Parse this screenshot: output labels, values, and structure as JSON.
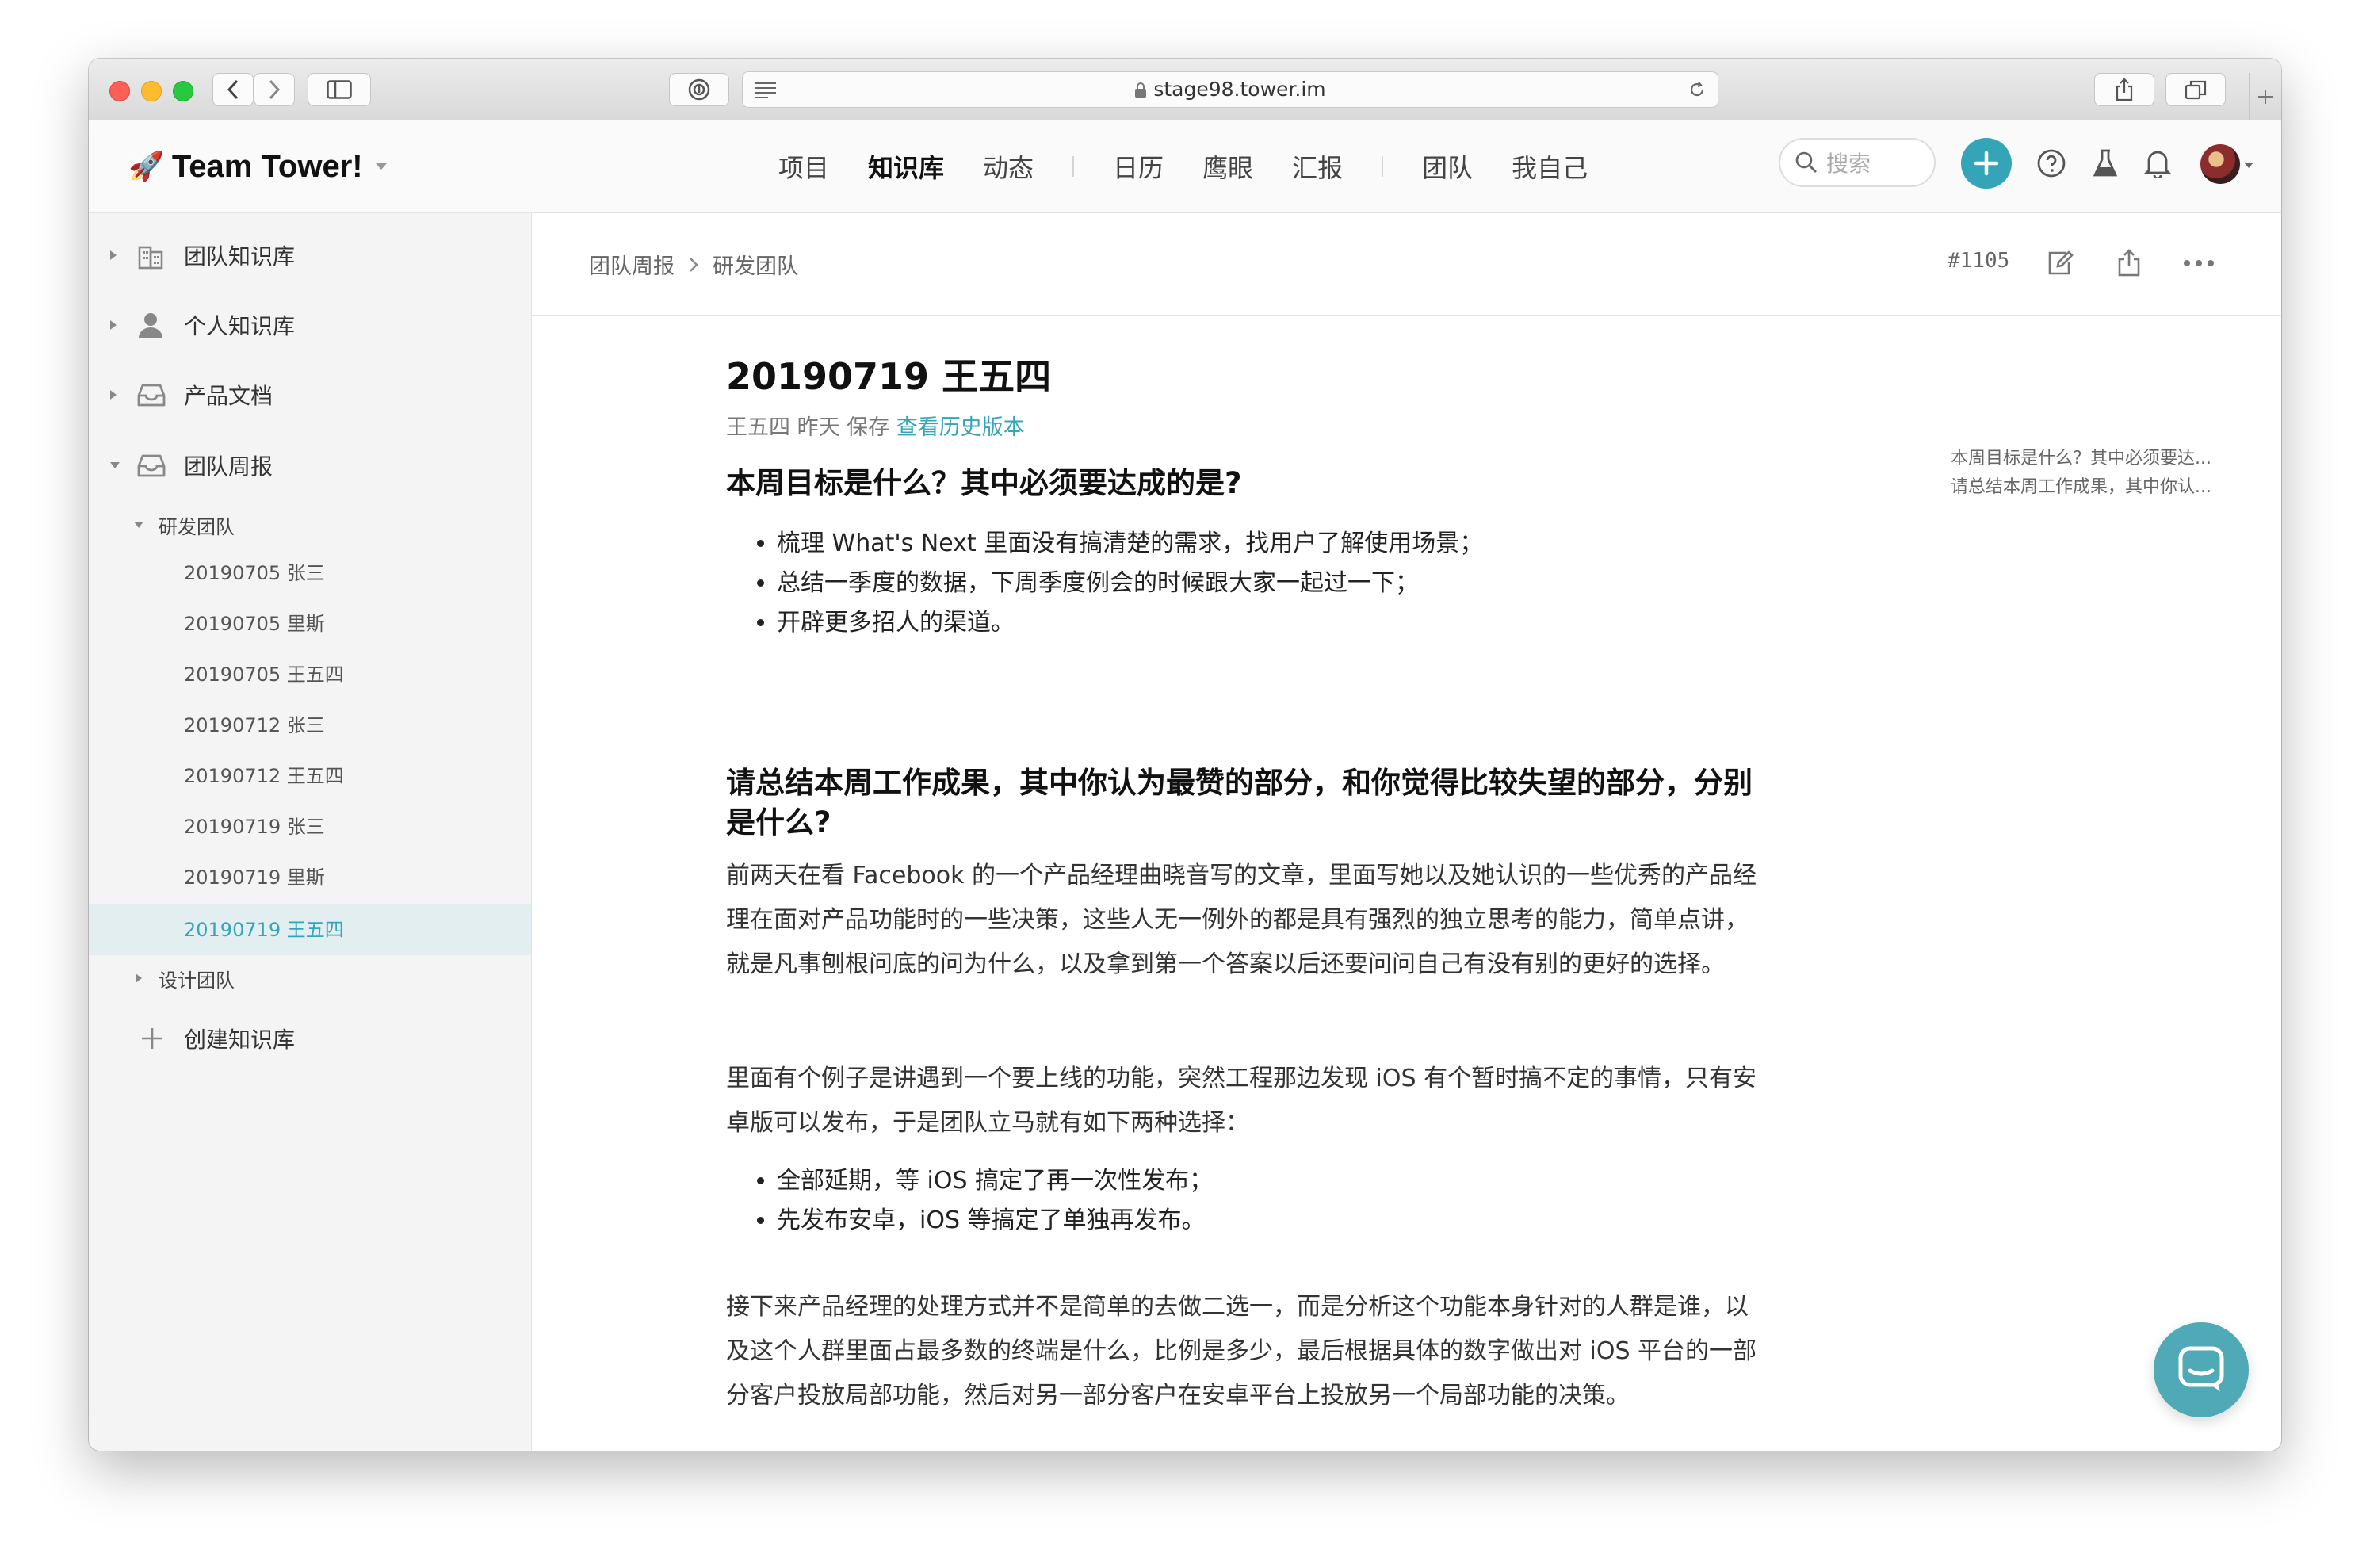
{
  "browser": {
    "url": "stage98.tower.im"
  },
  "header": {
    "brand": "Team Tower!",
    "nav": [
      {
        "label": "项目"
      },
      {
        "label": "知识库",
        "active": true
      },
      {
        "label": "动态"
      },
      {
        "label": "日历"
      },
      {
        "label": "鹰眼"
      },
      {
        "label": "汇报"
      },
      {
        "label": "团队"
      },
      {
        "label": "我自己"
      }
    ],
    "search_placeholder": "搜索"
  },
  "sidebar": {
    "sections": [
      {
        "label": "团队知识库",
        "icon": "building-icon"
      },
      {
        "label": "个人知识库",
        "icon": "person-icon"
      },
      {
        "label": "产品文档",
        "icon": "inbox-icon"
      },
      {
        "label": "团队周报",
        "icon": "inbox-icon",
        "expanded": true
      }
    ],
    "group_open": "研发团队",
    "docs": [
      {
        "label": "20190705 张三"
      },
      {
        "label": "20190705 里斯"
      },
      {
        "label": "20190705 王五四"
      },
      {
        "label": "20190712 张三"
      },
      {
        "label": "20190712 王五四"
      },
      {
        "label": "20190719 张三"
      },
      {
        "label": "20190719 里斯"
      },
      {
        "label": "20190719 王五四",
        "active": true
      }
    ],
    "group_closed": "设计团队",
    "create_label": "创建知识库"
  },
  "doc": {
    "breadcrumb": [
      "团队周报",
      "研发团队"
    ],
    "number": "#1105",
    "title": "20190719 王五四",
    "meta": "王五四 昨天 保存",
    "history_link": "查看历史版本",
    "q1": "本周目标是什么？其中必须要达成的是?",
    "q1_items": [
      "梳理 What's Next 里面没有搞清楚的需求，找用户了解使用场景；",
      "总结一季度的数据，下周季度例会的时候跟大家一起过一下；",
      "开辟更多招人的渠道。"
    ],
    "q2": "请总结本周工作成果，其中你认为最赞的部分，和你觉得比较失望的部分，分别是什么?",
    "p1": "前两天在看 Facebook 的一个产品经理曲晓音写的文章，里面写她以及她认识的一些优秀的产品经理在面对产品功能时的一些决策，这些人无一例外的都是具有强烈的独立思考的能力，简单点讲，就是凡事刨根问底的问为什么，以及拿到第一个答案以后还要问问自己有没有别的更好的选择。",
    "p2": "里面有个例子是讲遇到一个要上线的功能，突然工程那边发现 iOS 有个暂时搞不定的事情，只有安卓版可以发布，于是团队立马就有如下两种选择：",
    "q2_items": [
      "全部延期，等 iOS 搞定了再一次性发布；",
      "先发布安卓，iOS 等搞定了单独再发布。"
    ],
    "p3": "接下来产品经理的处理方式并不是简单的去做二选一，而是分析这个功能本身针对的人群是谁，以及这个人群里面占最多数的终端是什么，比例是多少，最后根据具体的数字做出对 iOS 平台的一部分客户投放局部功能，然后对另一部分客户在安卓平台上投放另一个局部功能的决策。"
  },
  "toc": [
    "本周目标是什么？其中必须要达...",
    "请总结本周工作成果，其中你认..."
  ],
  "colors": {
    "accent": "#35a5ba",
    "sidebar_bg": "#f4f4f4",
    "active_row": "#e2eef0"
  }
}
